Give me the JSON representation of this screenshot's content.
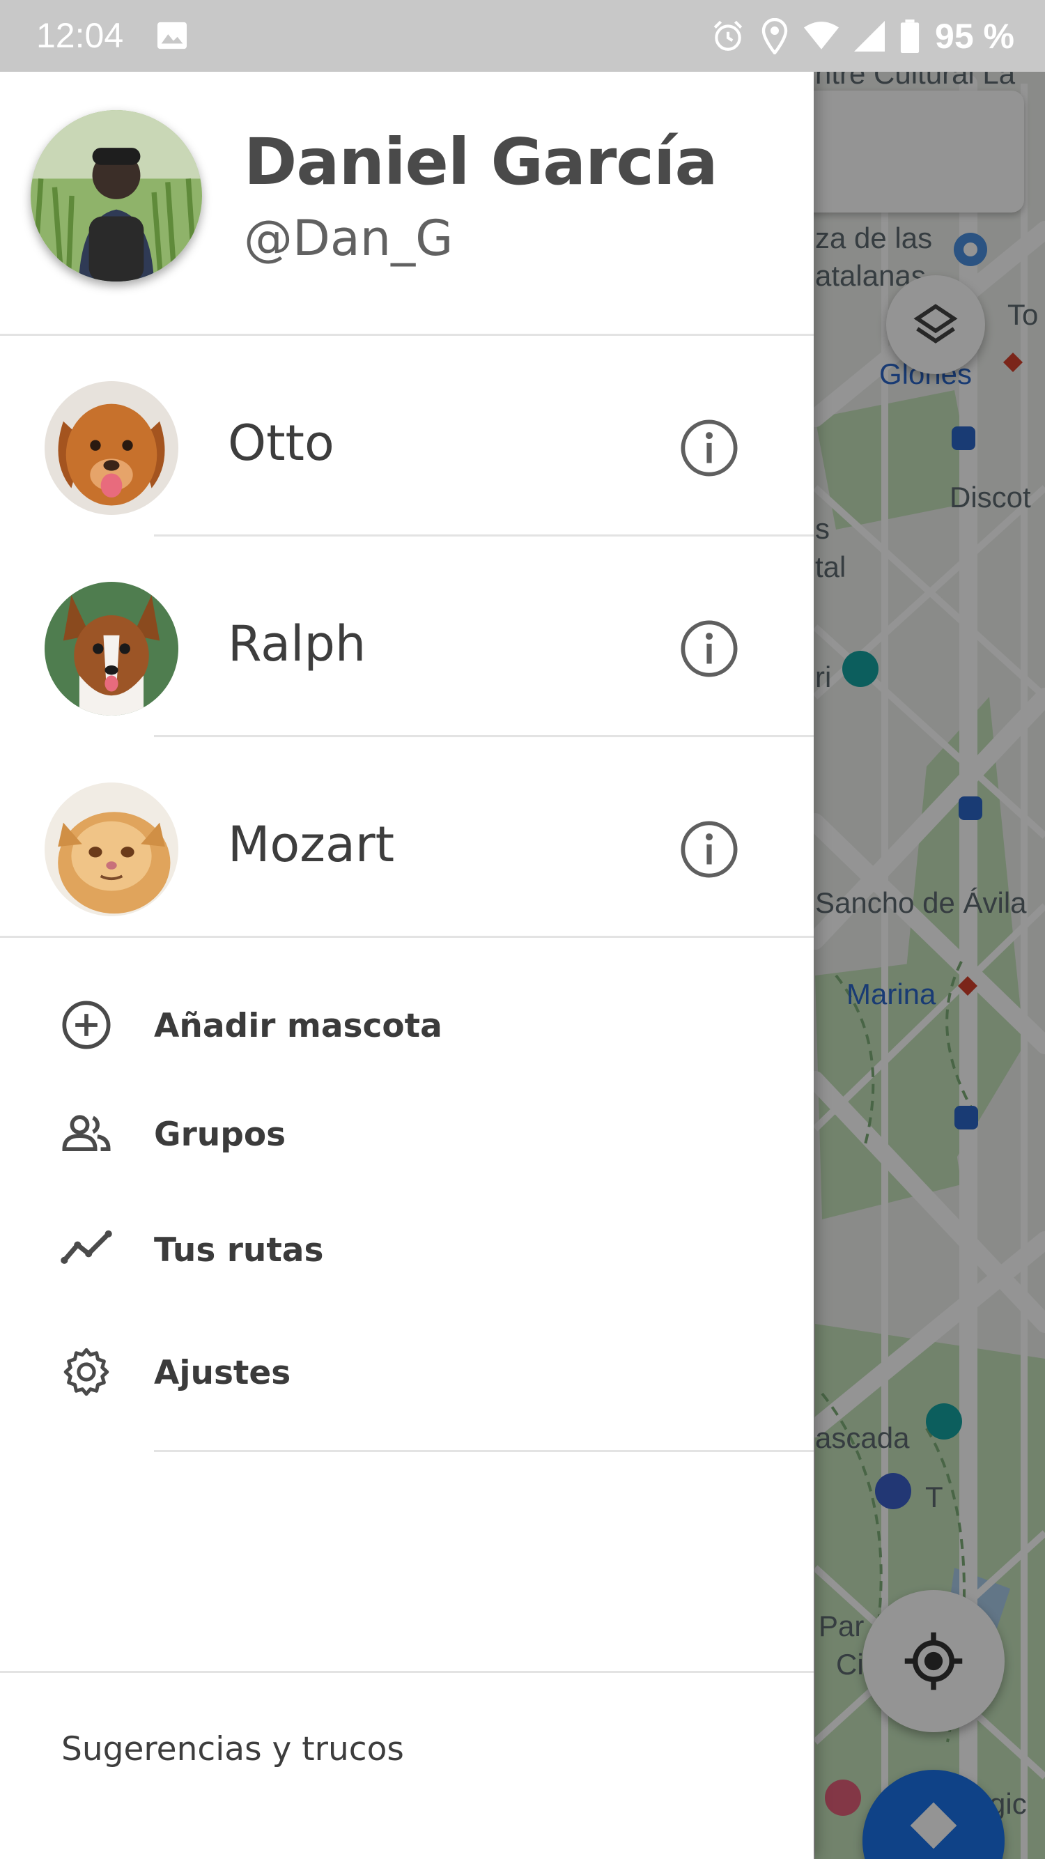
{
  "status_bar": {
    "time": "12:04",
    "battery_percent": "95 %",
    "icons": [
      "image-icon",
      "alarm-icon",
      "location-icon",
      "wifi-icon",
      "signal-icon",
      "battery-icon"
    ]
  },
  "profile": {
    "name": "Daniel García",
    "handle": "@Dan_G",
    "avatar_icon": "user-avatar"
  },
  "pets": [
    {
      "name": "Otto",
      "info_icon": "info-icon"
    },
    {
      "name": "Ralph",
      "info_icon": "info-icon"
    },
    {
      "name": "Mozart",
      "info_icon": "info-icon"
    }
  ],
  "menu": [
    {
      "label": "Añadir mascota",
      "icon": "add-circle-icon"
    },
    {
      "label": "Grupos",
      "icon": "people-icon"
    },
    {
      "label": "Tus rutas",
      "icon": "route-icon"
    },
    {
      "label": "Ajustes",
      "icon": "gear-icon"
    }
  ],
  "footer": {
    "tips_label": "Sugerencias y trucos"
  },
  "map": {
    "labels": [
      "ntre Cultural La",
      "za de las",
      "atalanas",
      "To",
      "Glories",
      "Discot",
      "s",
      "tal",
      "ri",
      "Sancho de Ávila",
      "Marina",
      "ascada",
      "T",
      "Par",
      "Ci",
      "gic"
    ]
  },
  "colors": {
    "drawer_bg": "#ffffff",
    "status_bar_bg": "#c8c8c8",
    "text_primary": "#3d3d3d",
    "map_park": "#b9dcb0",
    "metro_red": "#d4412c",
    "map_blue": "#2b66c8"
  }
}
